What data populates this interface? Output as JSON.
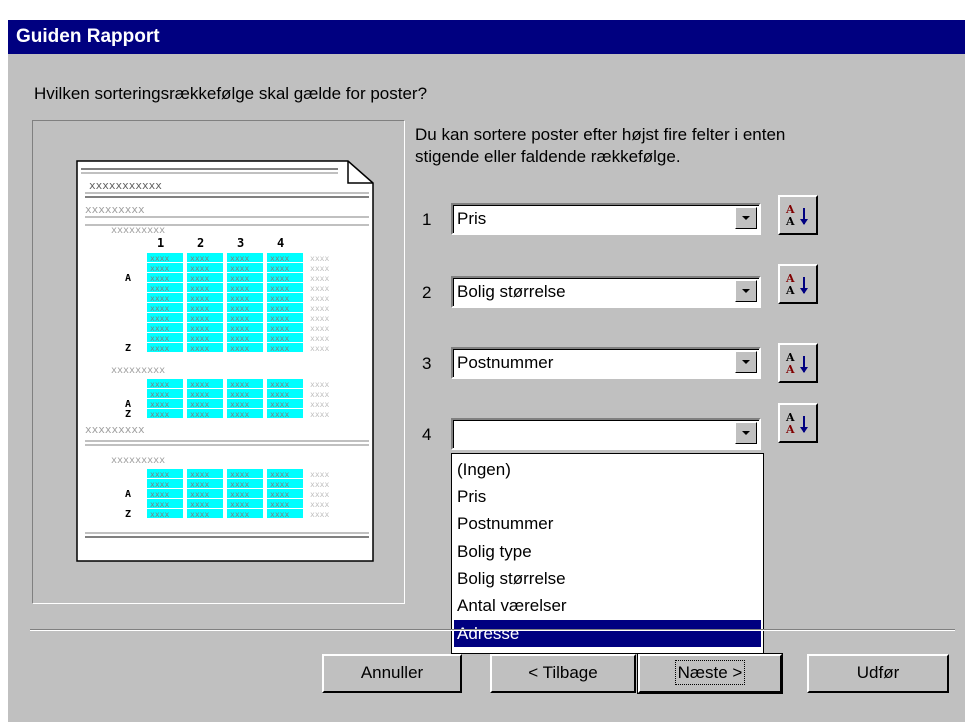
{
  "window": {
    "title": "Guiden Rapport"
  },
  "question": "Hvilken sorteringsrækkefølge skal gælde for poster?",
  "description": {
    "line1": "Du kan sortere poster efter højst fire felter i enten",
    "line2": "stigende eller faldende rækkefølge."
  },
  "preview": {
    "placeholder_long": "xxxxxxxxxxx",
    "placeholder": "xxxxxxxxx",
    "column_numbers": [
      "1",
      "2",
      "3",
      "4"
    ],
    "sort_glyph_a": "A",
    "sort_glyph_z": "Z"
  },
  "sort_rows": [
    {
      "number": "1",
      "value": "Pris",
      "sort_icon": "sort-ascending-icon"
    },
    {
      "number": "2",
      "value": "Bolig størrelse",
      "sort_icon": "sort-ascending-icon"
    },
    {
      "number": "3",
      "value": "Postnummer",
      "sort_icon": "sort-ascending-icon"
    },
    {
      "number": "4",
      "value": "",
      "sort_icon": "sort-ascending-icon"
    }
  ],
  "dropdown": {
    "options": [
      "(Ingen)",
      "Pris",
      "Postnummer",
      "Bolig type",
      "Bolig størrelse",
      "Antal værelser",
      "Adresse"
    ],
    "selected": "Adresse"
  },
  "buttons": {
    "cancel": "Annuller",
    "back": "< Tilbage",
    "next": "Næste >",
    "finish": "Udfør"
  },
  "colors": {
    "title_bar": "#000080",
    "dialog_bg": "#c0c0c0",
    "preview_highlight": "#00ffff",
    "selection": "#000080",
    "sort_letter_top": "#800000",
    "sort_arrow": "#000080"
  }
}
